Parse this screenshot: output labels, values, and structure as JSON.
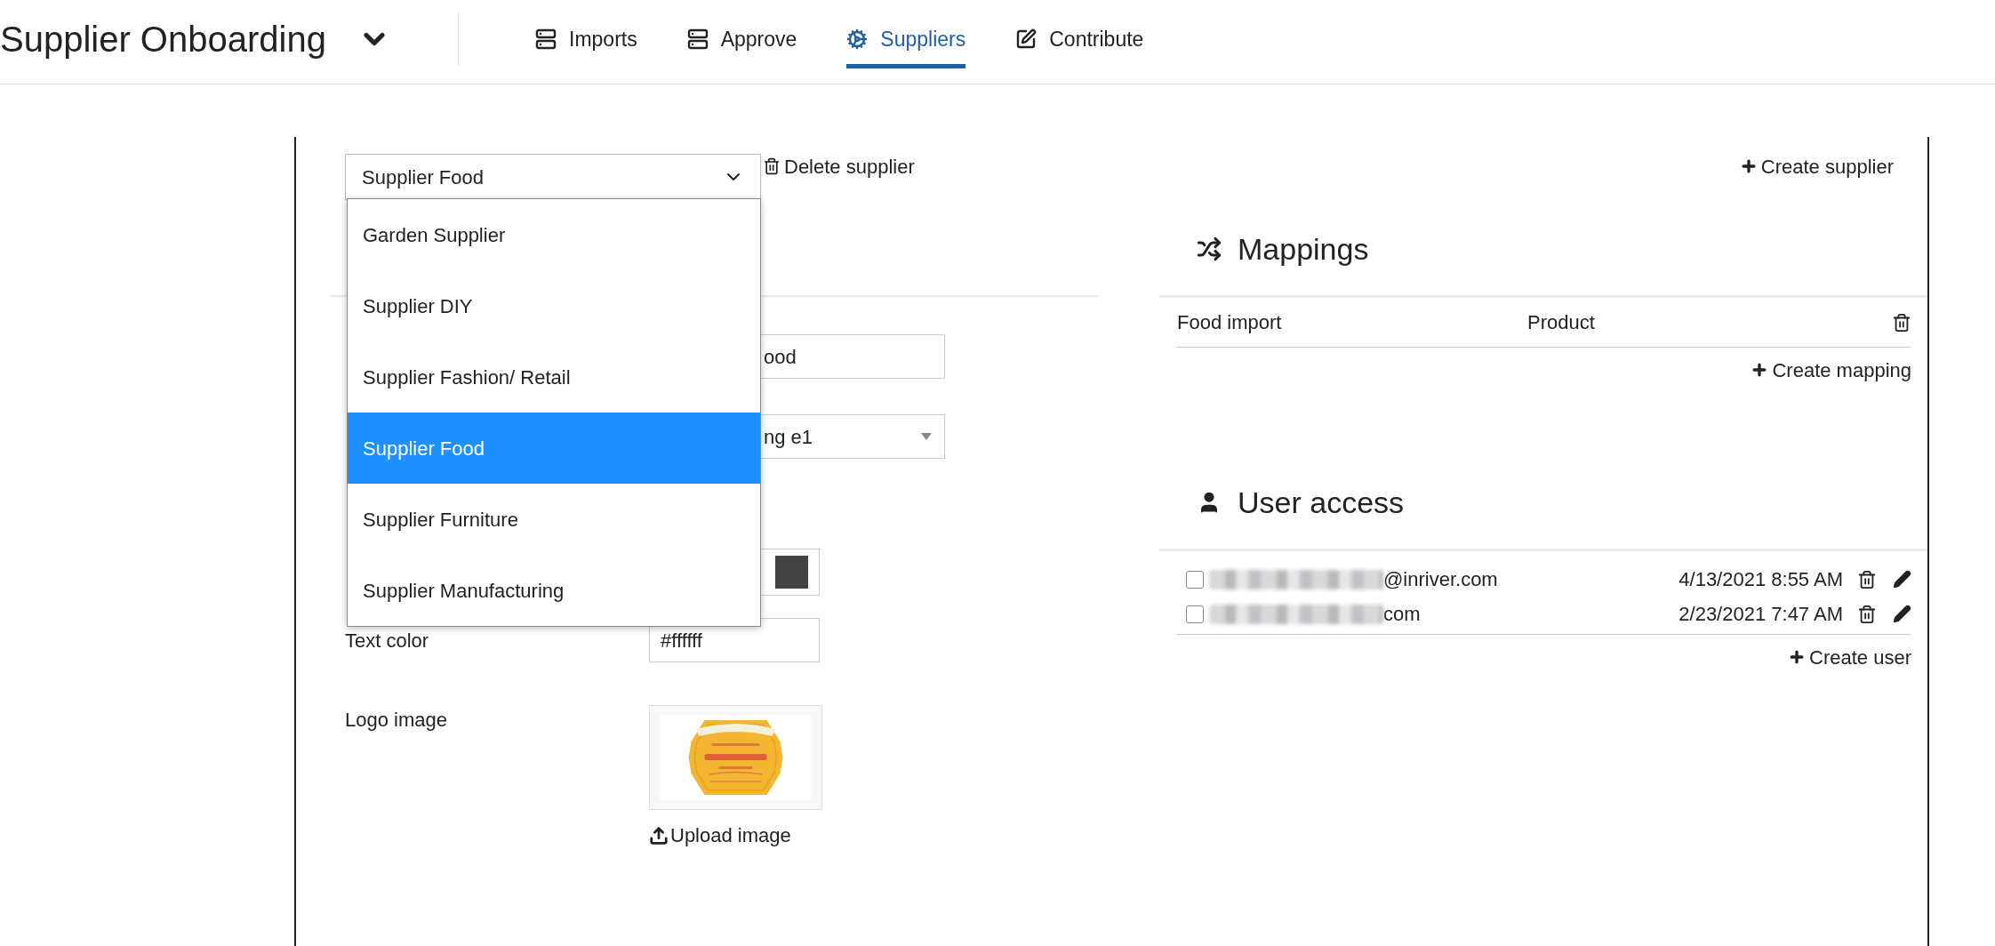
{
  "header": {
    "title": "Supplier Onboarding",
    "nav": [
      {
        "label": "Imports",
        "selected": false
      },
      {
        "label": "Approve",
        "selected": false
      },
      {
        "label": "Suppliers",
        "selected": true
      },
      {
        "label": "Contribute",
        "selected": false
      }
    ]
  },
  "supplier_select": {
    "value": "Supplier Food",
    "expanded": true,
    "options": [
      {
        "label": "Garden Supplier",
        "selected": false
      },
      {
        "label": "Supplier DIY",
        "selected": false
      },
      {
        "label": "Supplier Fashion/ Retail",
        "selected": false
      },
      {
        "label": "Supplier Food",
        "selected": true
      },
      {
        "label": "Supplier Furniture",
        "selected": false
      },
      {
        "label": "Supplier Manufacturing",
        "selected": false
      }
    ]
  },
  "delete_supplier": "Delete supplier",
  "create_supplier": "Create supplier",
  "form": [
    {
      "kind": "text",
      "value": "ood"
    },
    {
      "kind": "select",
      "value": "ng e1"
    },
    {
      "kind": "color",
      "color": "#444444"
    },
    {
      "kind": "text",
      "label": "Text color",
      "value": "#ffffff"
    },
    {
      "label": "Logo image",
      "action": "Upload image"
    }
  ],
  "mappings": {
    "title": "Mappings",
    "rows": [
      {
        "source": "Food import",
        "target": "Product"
      }
    ],
    "create": "Create mapping"
  },
  "user_access": {
    "title": "User access",
    "users": [
      {
        "checked": false,
        "email": "@inriver.com",
        "date": "4/13/2021 8:55 AM"
      },
      {
        "checked": false,
        "email": "com",
        "date": "2/23/2021 7:47 AM"
      }
    ],
    "create": "Create user"
  }
}
